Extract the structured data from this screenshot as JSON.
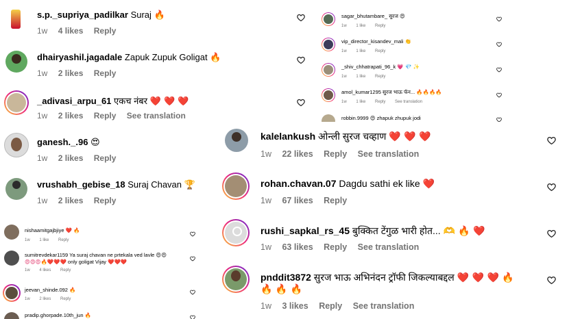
{
  "colors": {
    "accent_ring": "#ee2a7b",
    "meta_text": "#737373",
    "heart_red": "#e0245e",
    "flame": "#f57c00"
  },
  "panelA": {
    "comments": [
      {
        "user": "s.p._supriya_padilkar",
        "text": "Suraj",
        "emoji": "🔥",
        "time": "1w",
        "likes": "4 likes",
        "reply": "Reply"
      },
      {
        "user": "dhairyashil.jagadale",
        "text": "Zapuk Zupuk Goligat",
        "emoji": "🔥",
        "time": "1w",
        "likes": "2 likes",
        "reply": "Reply"
      },
      {
        "user": "_adivasi_arpu_61",
        "text": "एकच नंबर",
        "emoji": "❤️ ❤️ ❤️",
        "time": "1w",
        "likes": "2 likes",
        "reply": "Reply",
        "translate": "See translation"
      },
      {
        "user": "ganesh._.96",
        "text": "",
        "emoji": "😍",
        "time": "1w",
        "likes": "2 likes",
        "reply": "Reply"
      },
      {
        "user": "vrushabh_gebise_18",
        "text": "Suraj Chavan",
        "emoji": "🏆",
        "time": "1w",
        "likes": "2 likes",
        "reply": "Reply"
      }
    ]
  },
  "panelB": {
    "comments": [
      {
        "user": "sagar_bhutambare_",
        "text": "सुरज",
        "emoji": "😍",
        "time": "1w",
        "likes": "1 like",
        "reply": "Reply"
      },
      {
        "user": "vip_director_kisandev_mali",
        "text": "",
        "emoji": "👏",
        "time": "1w",
        "likes": "1 like",
        "reply": "Reply"
      },
      {
        "user": "_shiv_chhatrapati_96_k",
        "text": "",
        "emoji": "💗 💎 ✨",
        "time": "1w",
        "likes": "1 like",
        "reply": "Reply"
      },
      {
        "user": "amol_kumar1295",
        "text": "सुरज भाऊ फॅन...",
        "emoji": "🔥🔥🔥🔥",
        "time": "1w",
        "likes": "1 like",
        "reply": "Reply",
        "translate": "See translation"
      },
      {
        "user": "robbin.9999",
        "text": "zhapuk zhupuk jodi",
        "emoji": "😍",
        "time": "",
        "likes": "",
        "reply": ""
      }
    ]
  },
  "panelC": {
    "comments": [
      {
        "user": "nishaamitgajbjiye",
        "text": "",
        "emoji": "❤️ 🔥",
        "time": "1w",
        "likes": "1 like",
        "reply": "Reply"
      },
      {
        "user": "sumitrevdekar1159",
        "text": "Ya suraj chavan ne prtekala ved lavle",
        "text2": "only goligat Vijay",
        "emoji": "😍😍",
        "emoji2": "😍😍😍🔥❤️❤️❤️",
        "emoji3": "❤️❤️❤️",
        "time": "1w",
        "likes": "4 likes",
        "reply": "Reply"
      },
      {
        "user": "jeevan_shinde.092",
        "text": "",
        "emoji": "🔥",
        "time": "1w",
        "likes": "2 likes",
        "reply": "Reply"
      },
      {
        "user": "pradip.ghorpade.10th_jun",
        "text": "",
        "emoji": "🔥",
        "time": "",
        "likes": "",
        "reply": ""
      }
    ]
  },
  "panelD": {
    "comments": [
      {
        "user": "kalelankush",
        "text": "ओन्ली सुरज चव्हाण",
        "emoji": "❤️ ❤️ ❤️",
        "time": "1w",
        "likes": "22 likes",
        "reply": "Reply",
        "translate": "See translation"
      },
      {
        "user": "rohan.chavan.07",
        "text": "Dagdu sathi ek like",
        "emoji": "❤️",
        "time": "1w",
        "likes": "67 likes",
        "reply": "Reply"
      },
      {
        "user": "rushi_sapkal_rs_45",
        "text": "बुक्कित टेंगुळ भारी होत...",
        "emoji": "🫶 🔥 ❤️",
        "time": "1w",
        "likes": "63 likes",
        "reply": "Reply",
        "translate": "See translation"
      },
      {
        "user": "pnddit3872",
        "text": "सुरज भाऊ अभिनंदन ट्रॉफी जिकल्याबद्दल",
        "emoji": "❤️ ❤️ ❤️ 🔥",
        "emoji2": "🔥 🔥 🔥",
        "time": "1w",
        "likes": "3 likes",
        "reply": "Reply",
        "translate": "See translation"
      }
    ]
  }
}
